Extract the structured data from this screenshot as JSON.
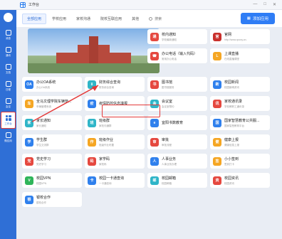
{
  "window": {
    "title": "工作台"
  },
  "sidebar": {
    "items": [
      {
        "label": "消息"
      },
      {
        "label": "通讯"
      },
      {
        "label": "文档"
      },
      {
        "label": "日程"
      },
      {
        "label": "会议"
      },
      {
        "label": "工作台"
      },
      {
        "label": "微应用"
      }
    ]
  },
  "tabs": [
    "全部应用",
    "学校应用",
    "家校沟通",
    "院校互联应用",
    "其他"
  ],
  "search": {
    "label": "搜索"
  },
  "add_button": {
    "label": "添加应用"
  },
  "apps": [
    {
      "name": "校内通知",
      "desc": "学校最新通知",
      "color": "#e5483f",
      "glyph": "通"
    },
    {
      "name": "官网",
      "desc": "http://www.qsxxy.cn/",
      "color": "#c9302c",
      "glyph": "官"
    },
    {
      "name": "办公电话（输入代码）",
      "desc": "常用办公电话",
      "color": "#e5483f",
      "glyph": "☎"
    },
    {
      "name": "上课直播",
      "desc": "在线直播课堂",
      "color": "#f5a623",
      "glyph": "L"
    },
    {
      "name": "办公OA系统",
      "desc": "办公OA系统",
      "color": "#2f80ed",
      "glyph": "OA"
    },
    {
      "name": "财务综合查询",
      "desc": "财务综合查询",
      "color": "#2fb5c8",
      "glyph": "¥"
    },
    {
      "name": "图书馆",
      "desc": "图书馆服务",
      "color": "#e5483f",
      "glyph": "书"
    },
    {
      "name": "校园新闻",
      "desc": "校园新闻资讯",
      "color": "#2f80ed",
      "glyph": "新"
    },
    {
      "name": "全马文理学院车辆管...",
      "desc": "车辆管理系统",
      "color": "#f5a623",
      "glyph": "车"
    },
    {
      "name": "疫情防控信息填报",
      "desc": "",
      "color": "#2f80ed",
      "glyph": "疫"
    },
    {
      "name": "会议室",
      "desc": "会议室预约",
      "color": "#2fb5c8",
      "glyph": "会"
    },
    {
      "name": "家校通讯录",
      "desc": "学校教职工通讯录",
      "color": "#e5483f",
      "glyph": "讯"
    },
    {
      "name": "家长通知",
      "desc": "家长通知",
      "color": "#2fb5c8",
      "glyph": "家"
    },
    {
      "name": "班级群",
      "desc": "家校沟通群",
      "color": "#2fb5c8",
      "glyph": "班"
    },
    {
      "name": "宜阳书数教育",
      "desc": "",
      "color": "#2f80ed",
      "glyph": "e"
    },
    {
      "name": "国家智慧教育公共服...",
      "desc": "国家智慧教育平台",
      "color": "#2f80ed",
      "glyph": "国"
    },
    {
      "name": "学生群",
      "desc": "学生交流群",
      "color": "#2f80ed",
      "glyph": "学"
    },
    {
      "name": "班级作业",
      "desc": "班级作业布置",
      "color": "#f5a623",
      "glyph": "作"
    },
    {
      "name": "审批",
      "desc": "审批流程",
      "color": "#e5483f",
      "glyph": "审"
    },
    {
      "name": "健康上报",
      "desc": "健康信息上报",
      "color": "#f5a623",
      "glyph": "健"
    },
    {
      "name": "党史学习",
      "desc": "党史学习",
      "color": "#e5483f",
      "glyph": "党"
    },
    {
      "name": "家学码",
      "desc": "家校码",
      "color": "#e5483f",
      "glyph": "码"
    },
    {
      "name": "人事业务",
      "desc": "人事业务办理",
      "color": "#2f80ed",
      "glyph": "人"
    },
    {
      "name": "小小签到",
      "desc": "签到打卡",
      "color": "#f5a623",
      "glyph": "签"
    },
    {
      "name": "校园VPN",
      "desc": "校园VPN",
      "color": "#2fb55a",
      "glyph": "V"
    },
    {
      "name": "校园一卡通查询",
      "desc": "一卡通查询",
      "color": "#2f80ed",
      "glyph": "卡"
    },
    {
      "name": "校园邮箱",
      "desc": "校园邮箱",
      "color": "#2fb5c8",
      "glyph": "邮"
    },
    {
      "name": "校园资讯",
      "desc": "校园资讯",
      "color": "#e5483f",
      "glyph": "资"
    },
    {
      "name": "银校合作",
      "desc": "银校合作",
      "color": "#2f80ed",
      "glyph": "银"
    }
  ]
}
